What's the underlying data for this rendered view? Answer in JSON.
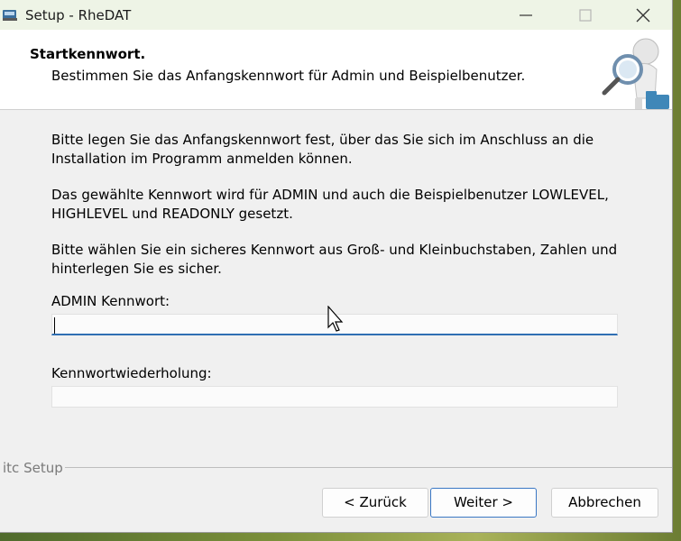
{
  "window": {
    "title": "Setup - RheDAT"
  },
  "header": {
    "title": "Startkennwort.",
    "subtitle": "Bestimmen Sie das Anfangskennwort für Admin und Beispielbenutzer."
  },
  "body": {
    "paragraph1_line1": "Bitte legen Sie das Anfangskennwort fest, über das Sie sich im Anschluss an die",
    "paragraph1_line2": "Installation im Programm anmelden können.",
    "paragraph2_line1": "Das gewählte Kennwort wird für ADMIN und auch die Beispielbenutzer LOWLEVEL,",
    "paragraph2_line2": "HIGHLEVEL und READONLY gesetzt.",
    "paragraph3_line1": "Bitte wählen Sie ein sicheres Kennwort aus Groß- und Kleinbuchstaben, Zahlen und",
    "paragraph3_line2": "hinterlegen Sie es sicher."
  },
  "form": {
    "admin_label": "ADMIN Kennwort:",
    "admin_value": "",
    "repeat_label": "Kennwortwiederholung:",
    "repeat_value": ""
  },
  "footer": {
    "group_label": "itc Setup",
    "back_label": "< Zurück",
    "next_label": "Weiter >",
    "cancel_label": "Abbrechen"
  },
  "colors": {
    "accent": "#2f6fb3",
    "titlebar": "#eef4e6"
  }
}
